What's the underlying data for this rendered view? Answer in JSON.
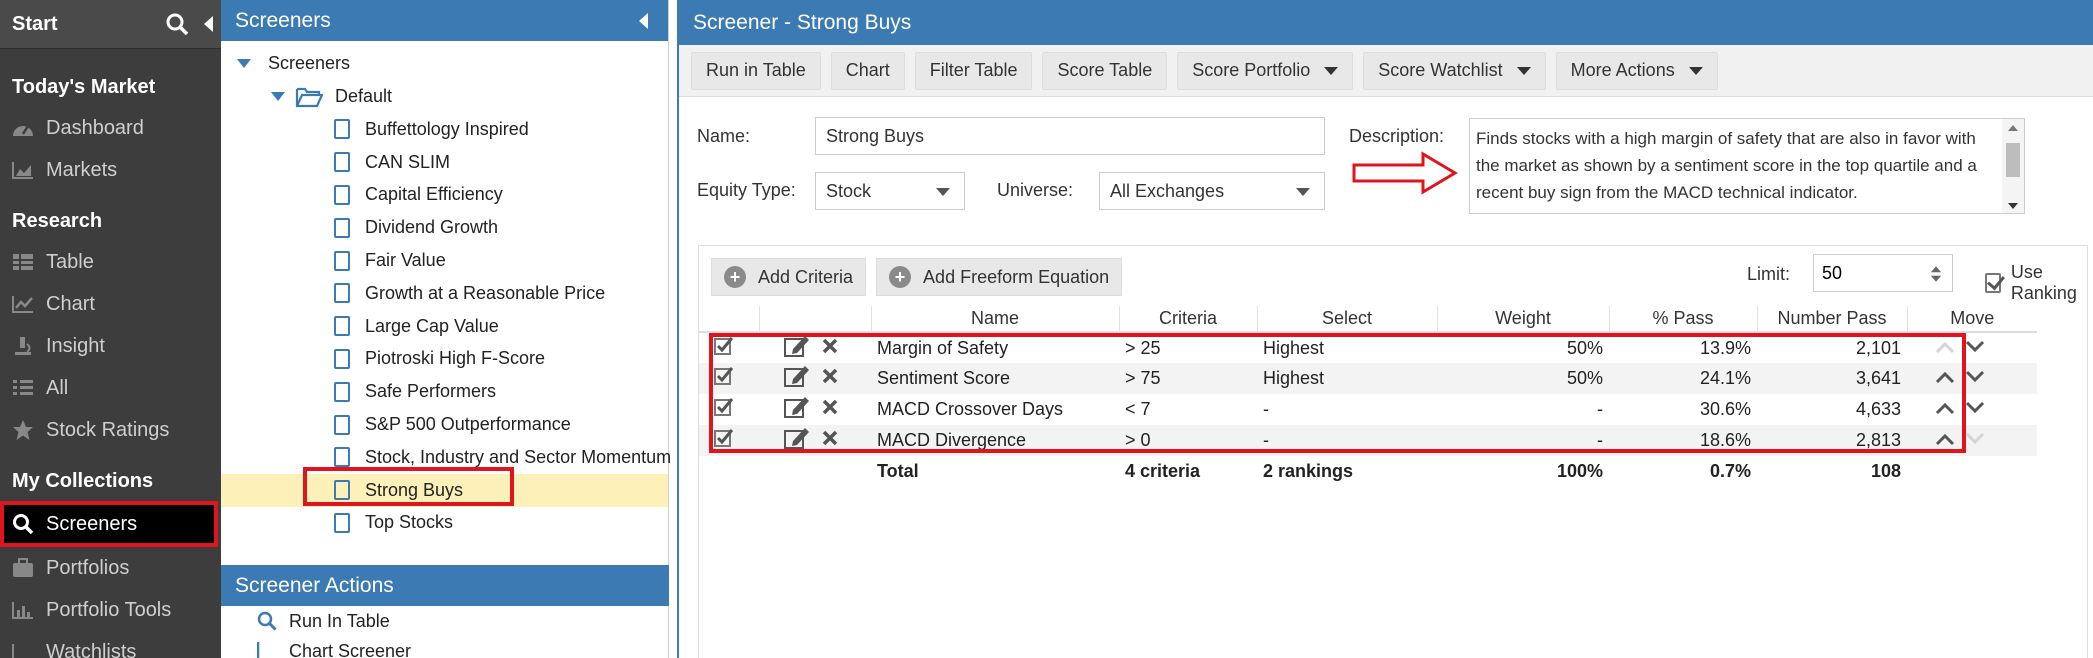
{
  "nav": {
    "start": "Start",
    "sections": [
      {
        "title": "Today's Market",
        "items": [
          "Dashboard",
          "Markets"
        ]
      },
      {
        "title": "Research",
        "items": [
          "Table",
          "Chart",
          "Insight",
          "All",
          "Stock Ratings"
        ]
      },
      {
        "title": "My Collections",
        "items": [
          "Screeners",
          "Portfolios",
          "Portfolio Tools",
          "Watchlists"
        ]
      }
    ],
    "active": "Screeners"
  },
  "tree": {
    "header": "Screeners",
    "root": "Screeners",
    "folder": "Default",
    "items": [
      "Buffettology Inspired",
      "CAN SLIM",
      "Capital Efficiency",
      "Dividend Growth",
      "Fair Value",
      "Growth at a Reasonable Price",
      "Large Cap Value",
      "Piotroski High F-Score",
      "Safe Performers",
      "S&P 500 Outperformance",
      "Stock, Industry and Sector Momentum",
      "Strong Buys",
      "Top Stocks"
    ],
    "selected": "Strong Buys",
    "actions_header": "Screener Actions",
    "actions": [
      "Run In Table",
      "Chart Screener"
    ]
  },
  "main": {
    "title": "Screener - Strong Buys",
    "toolbar": [
      "Run in Table",
      "Chart",
      "Filter Table",
      "Score Table",
      "Score Portfolio",
      "Score Watchlist",
      "More Actions"
    ],
    "form": {
      "name_label": "Name:",
      "name_value": "Strong Buys",
      "equity_label": "Equity Type:",
      "equity_value": "Stock",
      "universe_label": "Universe:",
      "universe_value": "All Exchanges",
      "description_label": "Description:",
      "description": "Finds stocks with a high margin of safety that are also in favor with the market as shown by a sentiment score in the top quartile and a recent buy sign from the MACD technical indicator."
    },
    "grid": {
      "add_criteria": "Add Criteria",
      "add_freeform": "Add Freeform Equation",
      "limit_label": "Limit:",
      "limit_value": "50",
      "use_ranking": "Use Ranking",
      "columns": [
        "Name",
        "Criteria",
        "Select",
        "Weight",
        "% Pass",
        "Number Pass",
        "Move"
      ],
      "rows": [
        {
          "name": "Margin of Safety",
          "criteria": "> 25",
          "select": "Highest",
          "weight": "50%",
          "pass_pct": "13.9%",
          "number_pass": "2,101"
        },
        {
          "name": "Sentiment Score",
          "criteria": "> 75",
          "select": "Highest",
          "weight": "50%",
          "pass_pct": "24.1%",
          "number_pass": "3,641"
        },
        {
          "name": "MACD Crossover Days",
          "criteria": "< 7",
          "select": "-",
          "weight": "-",
          "pass_pct": "30.6%",
          "number_pass": "4,633"
        },
        {
          "name": "MACD Divergence",
          "criteria": "> 0",
          "select": "-",
          "weight": "-",
          "pass_pct": "18.6%",
          "number_pass": "2,813"
        }
      ],
      "total": {
        "name": "Total",
        "criteria": "4 criteria",
        "select": "2 rankings",
        "weight": "100%",
        "pass_pct": "0.7%",
        "number_pass": "108"
      }
    }
  },
  "colors": {
    "header_blue": "#3c7ab4",
    "nav_bg": "#3d3d3d",
    "highlight_red": "#e0141c",
    "selected_bg": "#fdf0b9"
  }
}
